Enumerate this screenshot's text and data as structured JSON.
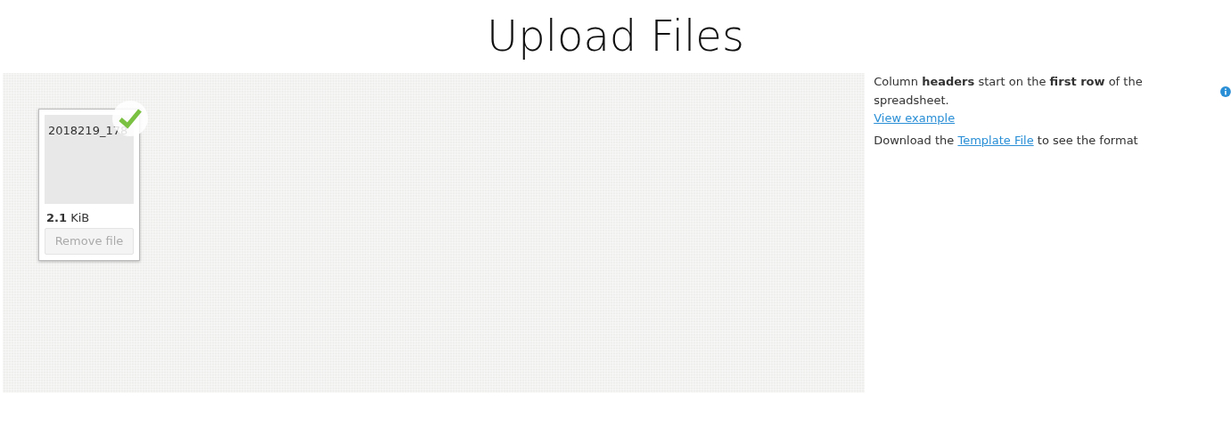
{
  "title": "Upload Files",
  "dropzone": {
    "files": [
      {
        "name": "2018219_178",
        "size_value": "2.1",
        "size_unit": "KiB",
        "uploaded": true,
        "remove_label": "Remove file"
      }
    ]
  },
  "help": {
    "note": "Column **headers** start on the **first row** of the spreadsheet.",
    "example_link": "View example",
    "download_before": "Download the ",
    "download_link": "Template File",
    "download_after": " to see the format"
  }
}
